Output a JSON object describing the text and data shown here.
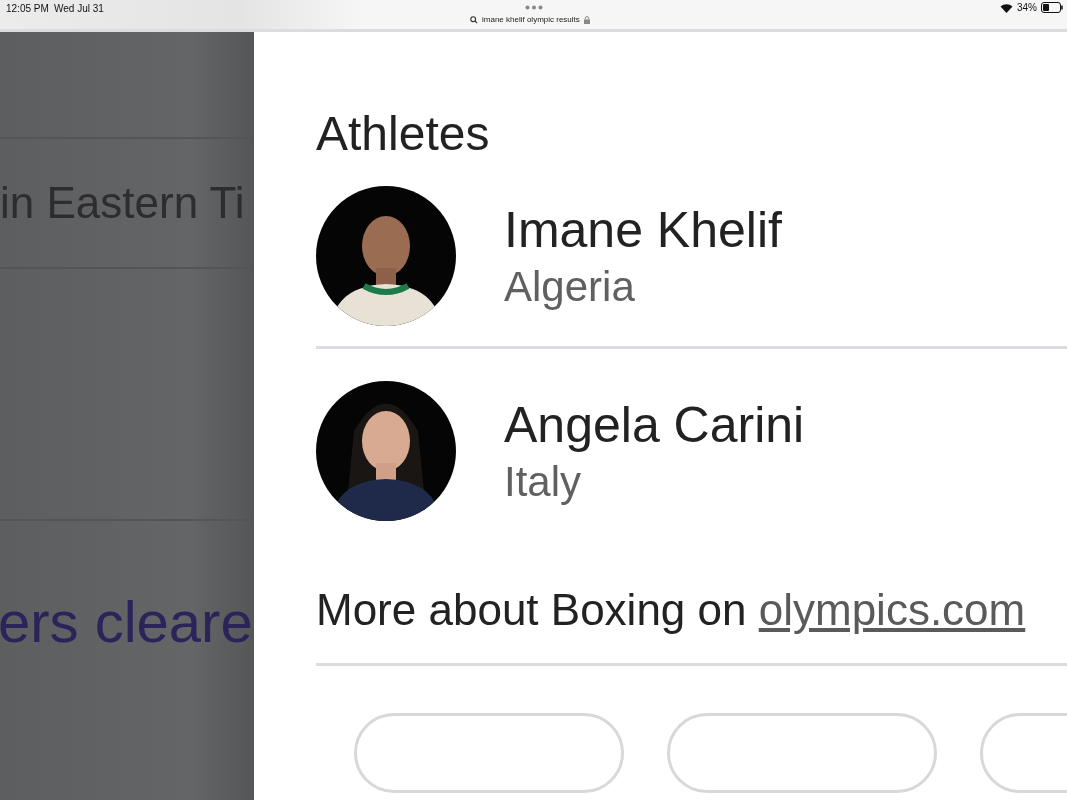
{
  "status_bar": {
    "time": "12:05 PM",
    "date": "Wed Jul 31",
    "address": "imane khelif olympic results",
    "battery": "34%"
  },
  "background_page": {
    "lines": [
      {
        "text": "in Eastern Ti",
        "kind": "plain"
      },
      {
        "text": "ers cleare",
        "kind": "link"
      }
    ]
  },
  "athletes": {
    "title": "Athletes",
    "items": [
      {
        "name": "Imane Khelif",
        "country": "Algeria",
        "kind": "picture"
      },
      {
        "name": "Angela Carini",
        "country": "Italy",
        "kind": "picture"
      }
    ],
    "more": {
      "text": "More about Boxing on ",
      "link": "olympics.com"
    },
    "chips": [
      {
        "kind": "pill"
      },
      {
        "kind": "pill"
      },
      {
        "kind": "pill"
      }
    ]
  }
}
